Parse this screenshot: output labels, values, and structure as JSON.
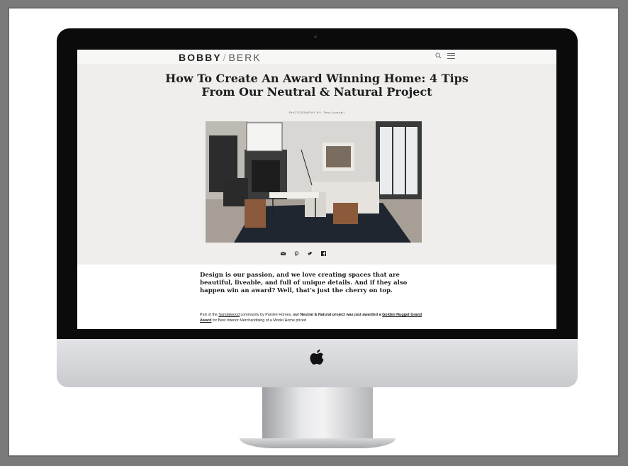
{
  "site": {
    "brand_bold": "BOBBY",
    "brand_slash": "/",
    "brand_light": "BERK"
  },
  "article": {
    "title": "How To Create An Award Winning Home: 4 Tips From Our Neutral & Natural Project",
    "photo_credit": "PHOTOGRAPHY BY: Tess Noesell",
    "lede": "Design is our passion, and we love creating spaces that are beautiful, liveable, and full of unique details. And if they also happen win an award? Well, that's just the cherry on top.",
    "para_prefix": "Part of the ",
    "para_link1": "Sandalwood",
    "para_mid": " community by Pardee Homes, ",
    "para_bold": "our Neutral & Natural project was just awarded a ",
    "para_link2": "Golden Nugget Grand Award",
    "para_suffix": " for Best Interior Merchandising of a Model Home priced"
  },
  "icons": {
    "search": "search-icon",
    "menu": "menu-icon",
    "share": [
      "email-icon",
      "pinterest-icon",
      "twitter-icon",
      "facebook-icon"
    ],
    "device_logo": "apple-logo-icon"
  },
  "colors": {
    "page_bg": "#efeeec",
    "text": "#1d1d1d",
    "bezel": "#0b0b0b"
  }
}
